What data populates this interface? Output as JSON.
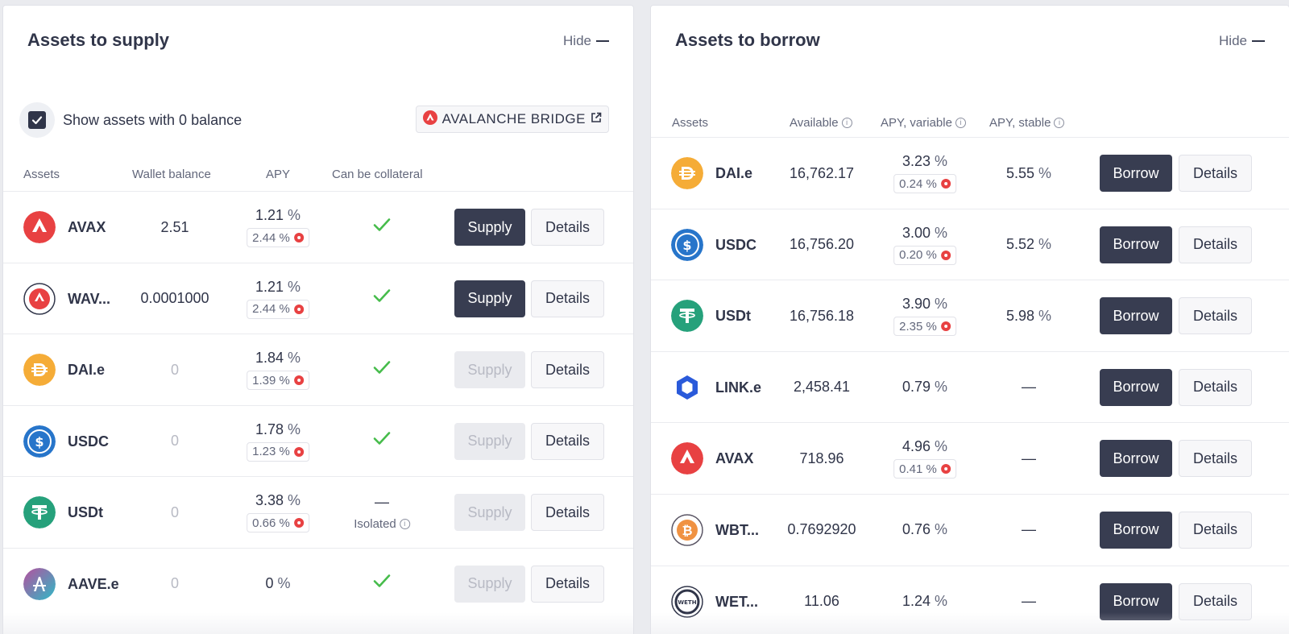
{
  "supply": {
    "title": "Assets to supply",
    "hide_label": "Hide",
    "show_zero_label": "Show assets with 0 balance",
    "bridge_label": "AVALANCHE BRIDGE",
    "headers": {
      "assets": "Assets",
      "wallet": "Wallet balance",
      "apy": "APY",
      "collateral": "Can be collateral"
    },
    "rows": [
      {
        "name": "AVAX",
        "balance": "2.51",
        "balance_muted": false,
        "apy": "1.21",
        "reward": "2.44",
        "collateral": "check",
        "supply_enabled": true,
        "icon": "avax-icon"
      },
      {
        "name": "WAV...",
        "balance": "0.0001000",
        "balance_muted": false,
        "apy": "1.21",
        "reward": "2.44",
        "collateral": "check",
        "supply_enabled": true,
        "icon": "wavax-icon"
      },
      {
        "name": "DAI.e",
        "balance": "0",
        "balance_muted": true,
        "apy": "1.84",
        "reward": "1.39",
        "collateral": "check",
        "supply_enabled": false,
        "icon": "dai-icon"
      },
      {
        "name": "USDC",
        "balance": "0",
        "balance_muted": true,
        "apy": "1.78",
        "reward": "1.23",
        "collateral": "check",
        "supply_enabled": false,
        "icon": "usdc-icon"
      },
      {
        "name": "USDt",
        "balance": "0",
        "balance_muted": true,
        "apy": "3.38",
        "reward": "0.66",
        "collateral": "isolated",
        "supply_enabled": false,
        "icon": "usdt-icon"
      },
      {
        "name": "AAVE.e",
        "balance": "0",
        "balance_muted": true,
        "apy": "0",
        "reward": null,
        "collateral": "check",
        "supply_enabled": false,
        "icon": "aave-icon"
      }
    ],
    "supply_label": "Supply",
    "details_label": "Details",
    "isolated_dash": "—",
    "isolated_label": "Isolated",
    "pct_sign": "%"
  },
  "borrow": {
    "title": "Assets to borrow",
    "hide_label": "Hide",
    "headers": {
      "assets": "Assets",
      "available": "Available",
      "apy_variable": "APY, variable",
      "apy_stable": "APY, stable"
    },
    "rows": [
      {
        "name": "DAI.e",
        "available": "16,762.17",
        "apy_variable": "3.23",
        "reward": "0.24",
        "apy_stable": "5.55",
        "icon": "dai-icon"
      },
      {
        "name": "USDC",
        "available": "16,756.20",
        "apy_variable": "3.00",
        "reward": "0.20",
        "apy_stable": "5.52",
        "icon": "usdc-icon"
      },
      {
        "name": "USDt",
        "available": "16,756.18",
        "apy_variable": "3.90",
        "reward": "2.35",
        "apy_stable": "5.98",
        "icon": "usdt-icon"
      },
      {
        "name": "LINK.e",
        "available": "2,458.41",
        "apy_variable": "0.79",
        "reward": null,
        "apy_stable": null,
        "icon": "link-icon"
      },
      {
        "name": "AVAX",
        "available": "718.96",
        "apy_variable": "4.96",
        "reward": "0.41",
        "apy_stable": null,
        "icon": "avax-icon"
      },
      {
        "name": "WBT...",
        "available": "0.7692920",
        "apy_variable": "0.76",
        "reward": null,
        "apy_stable": null,
        "icon": "wbtc-icon"
      },
      {
        "name": "WET...",
        "available": "11.06",
        "apy_variable": "1.24",
        "reward": null,
        "apy_stable": null,
        "icon": "weth-icon"
      }
    ],
    "borrow_label": "Borrow",
    "details_label": "Details",
    "dash": "—",
    "pct_sign": "%"
  },
  "colors": {
    "primary_button": "#383d51",
    "check": "#46bc4b",
    "avax_red": "#e84142"
  }
}
